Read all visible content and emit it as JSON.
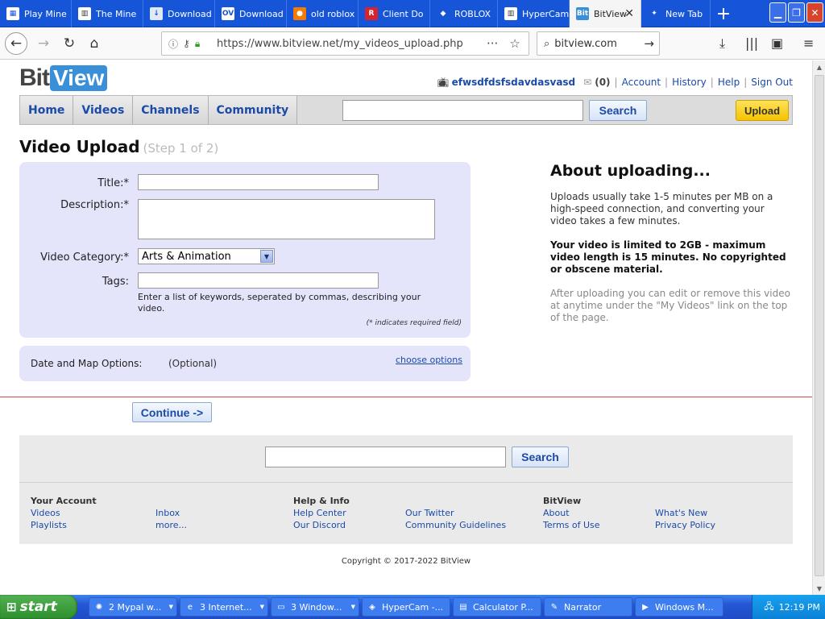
{
  "browser": {
    "tabs": [
      {
        "label": "Play Mine",
        "icon": "grid-icon",
        "iconText": "▦",
        "iconBg": "#ffffff",
        "iconColor": "#1655d8"
      },
      {
        "label": "The Mine",
        "icon": "library-icon",
        "iconText": "▥",
        "iconBg": "#ffffff",
        "iconColor": "#333333"
      },
      {
        "label": "Download",
        "icon": "download-site-icon",
        "iconText": "↓",
        "iconBg": "#dfe9f8",
        "iconColor": "#1655d8"
      },
      {
        "label": "Download",
        "icon": "ov-icon",
        "iconText": "OV",
        "iconBg": "#ffffff",
        "iconColor": "#1655d8"
      },
      {
        "label": "old roblox",
        "icon": "rocket-icon",
        "iconText": "●",
        "iconBg": "#f57c00",
        "iconColor": "#ffffff"
      },
      {
        "label": "Client Do",
        "icon": "r-icon",
        "iconText": "R",
        "iconBg": "#d8222c",
        "iconColor": "#ffffff"
      },
      {
        "label": "ROBLOX",
        "icon": "roblox-icon",
        "iconText": "◆",
        "iconBg": "#1655d8",
        "iconColor": "#ffffff"
      },
      {
        "label": "HyperCam",
        "icon": "library-icon",
        "iconText": "▥",
        "iconBg": "#ffffff",
        "iconColor": "#333333"
      },
      {
        "label": "BitView",
        "icon": "bitview-icon",
        "iconText": "Bit",
        "iconBg": "#3a8fd9",
        "iconColor": "#ffffff"
      },
      {
        "label": "New Tab",
        "icon": "firefox-icon",
        "iconText": "✦",
        "iconBg": "#1655d8",
        "iconColor": "#ffffff"
      }
    ],
    "activeTab": 8,
    "url": "https://www.bitview.net/my_videos_upload.php",
    "search": "bitview.com"
  },
  "header": {
    "logo_part1": "Bit",
    "logo_part2": "View",
    "username": "efwsdfdsfsdavdasvasd",
    "inbox_count": "(0)",
    "links": [
      "Account",
      "History",
      "Help",
      "Sign Out"
    ]
  },
  "nav": {
    "items": [
      "Home",
      "Videos",
      "Channels",
      "Community"
    ],
    "search_button": "Search",
    "upload_button": "Upload"
  },
  "page": {
    "title": "Video Upload",
    "step": "(Step 1 of 2)"
  },
  "form": {
    "title_label": "Title:*",
    "description_label": "Description:*",
    "category_label": "Video Category:*",
    "category_value": "Arts & Animation",
    "tags_label": "Tags:",
    "tags_hint": "Enter a list of keywords, seperated by commas, describing your video.",
    "required_note": "(* indicates required field)"
  },
  "options": {
    "label": "Date and Map Options:",
    "optional": "(Optional)",
    "link": "choose options"
  },
  "about": {
    "heading": "About uploading...",
    "p1": "Uploads usually take 1-5 minutes per MB on a high-speed connection, and converting your video takes a few minutes.",
    "p2": "Your video is limited to 2GB - maximum video length is 15 minutes. No copyrighted or obscene material.",
    "p3": "After uploading you can edit or remove this video at anytime under the \"My Videos\" link on the top of the page."
  },
  "continue_button": "Continue ->",
  "footer": {
    "search_button": "Search",
    "columns": [
      {
        "title": "Your Account",
        "links": [
          [
            "Videos",
            "Inbox"
          ],
          [
            "Playlists",
            "more..."
          ]
        ]
      },
      {
        "title": "Help & Info",
        "links": [
          [
            "Help Center",
            "Our Twitter"
          ],
          [
            "Our Discord",
            "Community Guidelines"
          ]
        ]
      },
      {
        "title": "BitView",
        "links": [
          [
            "About",
            "What's New"
          ],
          [
            "Terms of Use",
            "Privacy Policy"
          ]
        ]
      }
    ],
    "copyright": "Copyright © 2017-2022 BitView"
  },
  "taskbar": {
    "start": "start",
    "tasks": [
      {
        "label": "2 Mypal w...",
        "icon": "mypal-icon",
        "iconText": "✺",
        "arrow": true
      },
      {
        "label": "3 Internet...",
        "icon": "ie-icon",
        "iconText": "e",
        "arrow": true
      },
      {
        "label": "3 Window...",
        "icon": "folder-icon",
        "iconText": "▭",
        "arrow": true
      },
      {
        "label": "HyperCam -...",
        "icon": "hypercam-icon",
        "iconText": "◈",
        "arrow": false
      },
      {
        "label": "Calculator P...",
        "icon": "calculator-icon",
        "iconText": "▤",
        "arrow": false
      },
      {
        "label": "Narrator",
        "icon": "narrator-icon",
        "iconText": "✎",
        "arrow": false
      },
      {
        "label": "Windows M...",
        "icon": "media-player-icon",
        "iconText": "▶",
        "arrow": false
      }
    ],
    "clock": "12:19 PM"
  }
}
